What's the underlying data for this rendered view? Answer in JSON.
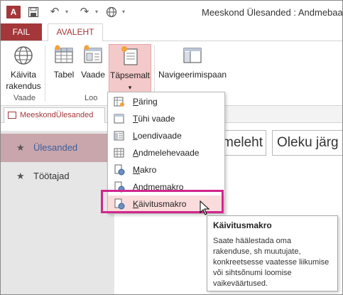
{
  "window": {
    "title": "Meeskond Ülesanded : Andmebaas"
  },
  "qat": {
    "app_icon_label": "A",
    "icons": [
      "save-icon",
      "undo-icon",
      "redo-icon",
      "globe-icon"
    ]
  },
  "tabs": {
    "file": "FAIL",
    "home": "AVALEHT"
  },
  "ribbon": {
    "launch": {
      "line1": "Käivita",
      "line2": "rakendus"
    },
    "table": "Tabel",
    "view": "Vaade",
    "advanced": "Täpsemalt",
    "navigation": "Navigeerimispaan",
    "group_view": "Vaade",
    "group_create": "Loo"
  },
  "document_tab": {
    "label": "MeeskondÜlesanded"
  },
  "nav": {
    "items": [
      {
        "label": "Ülesanded"
      },
      {
        "label": "Töötajad"
      }
    ]
  },
  "fields": {
    "field1": "meleht",
    "field2": "Oleku järg"
  },
  "dropdown": {
    "items": [
      {
        "underline": "P",
        "rest": "äring",
        "icon": "query-icon"
      },
      {
        "underline": "T",
        "rest": "ühi vaade",
        "icon": "blank-view-icon"
      },
      {
        "underline": "L",
        "rest": "oendivaade",
        "icon": "list-view-icon"
      },
      {
        "underline": "A",
        "rest": "ndmelehevaade",
        "icon": "datasheet-view-icon"
      },
      {
        "underline": "M",
        "rest": "akro",
        "icon": "macro-icon"
      },
      {
        "underline": "",
        "rest": "Andmemakro",
        "icon": "data-macro-icon"
      },
      {
        "underline": "K",
        "rest": "äivitusmakro",
        "icon": "startup-macro-icon"
      }
    ]
  },
  "tooltip": {
    "title": "Käivitusmakro",
    "body": "Saate häälestada oma rakenduse, sh muutujate, konkreetsesse vaatesse liikumise või sihtsõnumi loomise vaikeväärtused."
  },
  "colors": {
    "accent": "#a4373a",
    "selected_nav": "#c9a6ab",
    "highlight": "#d1268d",
    "hover": "#fadcdc"
  }
}
